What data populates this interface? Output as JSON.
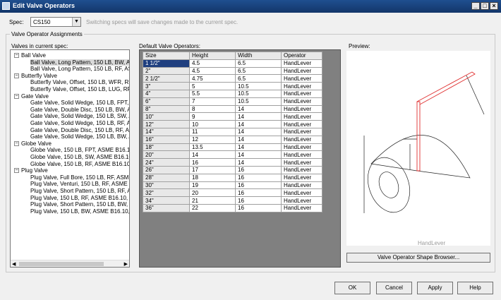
{
  "window": {
    "title": "Edit Valve Operators"
  },
  "spec": {
    "label": "Spec:",
    "value": "CS150",
    "note": "Switching specs will save changes made to the current spec."
  },
  "group_title": "Valve Operator Assignments",
  "tree": {
    "label": "Valves in current spec:",
    "nodes": [
      {
        "text": "Ball Valve",
        "level": 0
      },
      {
        "text": "Ball Valve, Long Pattern, 150 LB, BW, AS",
        "level": 1,
        "selected": true
      },
      {
        "text": "Ball Valve, Long Pattern, 150 LB, RF, AS",
        "level": 1
      },
      {
        "text": "Butterfly Valve",
        "level": 0
      },
      {
        "text": "Butterfly Valve, Offset, 150 LB, WFR, RF",
        "level": 1
      },
      {
        "text": "Butterfly Valve, Offset, 150 LB, LUG, RF,",
        "level": 1
      },
      {
        "text": "Gate Valve",
        "level": 0
      },
      {
        "text": "Gate Valve, Solid Wedge, 150 LB, FPT, A",
        "level": 1
      },
      {
        "text": "Gate Valve, Double Disc, 150 LB, BW, AS",
        "level": 1
      },
      {
        "text": "Gate Valve, Solid Wedge, 150 LB, SW, A",
        "level": 1
      },
      {
        "text": "Gate Valve, Solid Wedge, 150 LB, RF, AS",
        "level": 1
      },
      {
        "text": "Gate Valve, Double Disc, 150 LB, RF, AS",
        "level": 1
      },
      {
        "text": "Gate Valve, Solid Wedge, 150 LB, BW, A",
        "level": 1
      },
      {
        "text": "Globe Valve",
        "level": 0
      },
      {
        "text": "Globe Valve, 150 LB, FPT, ASME B16.10,",
        "level": 1
      },
      {
        "text": "Globe Valve, 150 LB, SW, ASME B16.10,",
        "level": 1
      },
      {
        "text": "Globe Valve, 150 LB, RF, ASME B16.10, A",
        "level": 1
      },
      {
        "text": "Plug Valve",
        "level": 0
      },
      {
        "text": "Plug Valve, Full Bore, 150 LB, RF, ASME",
        "level": 1
      },
      {
        "text": "Plug Valve, Venturi, 150 LB, RF, ASME B",
        "level": 1
      },
      {
        "text": "Plug Valve, Short Pattern, 150 LB, RF, A",
        "level": 1
      },
      {
        "text": "Plug Valve, 150 LB, RF, ASME B16.10, A",
        "level": 1
      },
      {
        "text": "Plug Valve, Short Pattern, 150 LB, BW, A",
        "level": 1
      },
      {
        "text": "Plug Valve, 150 LB, BW, ASME B16.10, A",
        "level": 1
      }
    ]
  },
  "operators": {
    "label": "Default Valve Operators:",
    "columns": [
      "Size",
      "Height",
      "Width",
      "Operator"
    ],
    "rows": [
      [
        "1 1/2\"",
        "4.5",
        "6.5",
        "HandLever"
      ],
      [
        "2\"",
        "4.5",
        "6.5",
        "HandLever"
      ],
      [
        "2 1/2\"",
        "4.75",
        "6.5",
        "HandLever"
      ],
      [
        "3\"",
        "5",
        "10.5",
        "HandLever"
      ],
      [
        "4\"",
        "5.5",
        "10.5",
        "HandLever"
      ],
      [
        "6\"",
        "7",
        "10.5",
        "HandLever"
      ],
      [
        "8\"",
        "8",
        "14",
        "HandLever"
      ],
      [
        "10\"",
        "9",
        "14",
        "HandLever"
      ],
      [
        "12\"",
        "10",
        "14",
        "HandLever"
      ],
      [
        "14\"",
        "11",
        "14",
        "HandLever"
      ],
      [
        "16\"",
        "12",
        "14",
        "HandLever"
      ],
      [
        "18\"",
        "13.5",
        "14",
        "HandLever"
      ],
      [
        "20\"",
        "14",
        "14",
        "HandLever"
      ],
      [
        "24\"",
        "16",
        "14",
        "HandLever"
      ],
      [
        "26\"",
        "17",
        "16",
        "HandLever"
      ],
      [
        "28\"",
        "18",
        "16",
        "HandLever"
      ],
      [
        "30\"",
        "19",
        "16",
        "HandLever"
      ],
      [
        "32\"",
        "20",
        "16",
        "HandLever"
      ],
      [
        "34\"",
        "21",
        "16",
        "HandLever"
      ],
      [
        "36\"",
        "22",
        "16",
        "HandLever"
      ]
    ]
  },
  "preview": {
    "label": "Preview:",
    "caption": "HandLever",
    "shape_button": "Valve Operator Shape Browser..."
  },
  "buttons": {
    "ok": "OK",
    "cancel": "Cancel",
    "apply": "Apply",
    "help": "Help"
  },
  "colors": {
    "title_bar": "#1f4f8f",
    "selection": "#1f3f7f",
    "handle": "#e03030"
  }
}
